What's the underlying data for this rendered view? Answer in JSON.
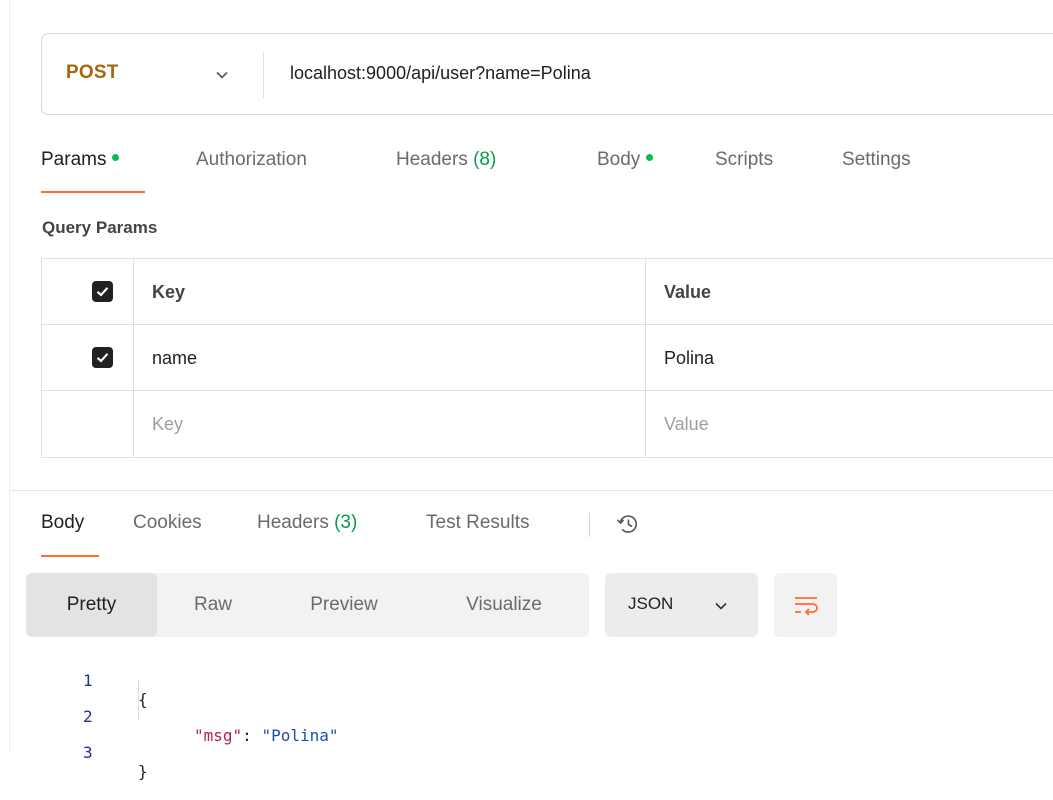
{
  "request": {
    "method": "POST",
    "url": "localhost:9000/api/user?name=Polina"
  },
  "request_tabs": [
    {
      "label": "Params",
      "dot": true
    },
    {
      "label": "Authorization"
    },
    {
      "label": "Headers",
      "count": "(8)"
    },
    {
      "label": "Body",
      "dot": true
    },
    {
      "label": "Scripts"
    },
    {
      "label": "Settings"
    }
  ],
  "query_params": {
    "title": "Query Params",
    "header": {
      "key": "Key",
      "value": "Value"
    },
    "rows": [
      {
        "key": "name",
        "value": "Polina",
        "checked": true
      }
    ],
    "placeholder": {
      "key": "Key",
      "value": "Value"
    }
  },
  "response_tabs": [
    {
      "label": "Body"
    },
    {
      "label": "Cookies"
    },
    {
      "label": "Headers",
      "count": "(3)"
    },
    {
      "label": "Test Results"
    }
  ],
  "format_buttons": [
    "Pretty",
    "Raw",
    "Preview",
    "Visualize"
  ],
  "format_select": "JSON",
  "code_lines": [
    {
      "num": "1",
      "text": "{"
    },
    {
      "num": "2",
      "key": "\"msg\"",
      "sep": ": ",
      "value": "\"Polina\""
    },
    {
      "num": "3",
      "text": "}"
    }
  ],
  "colors": {
    "method": "#a8660c",
    "accent": "#ff6c37",
    "dot": "#0cbb52",
    "count": "#0a9c46"
  },
  "icons": [
    "chevron-down-icon",
    "checkbox-checked-icon",
    "history-icon",
    "word-wrap-icon"
  ]
}
